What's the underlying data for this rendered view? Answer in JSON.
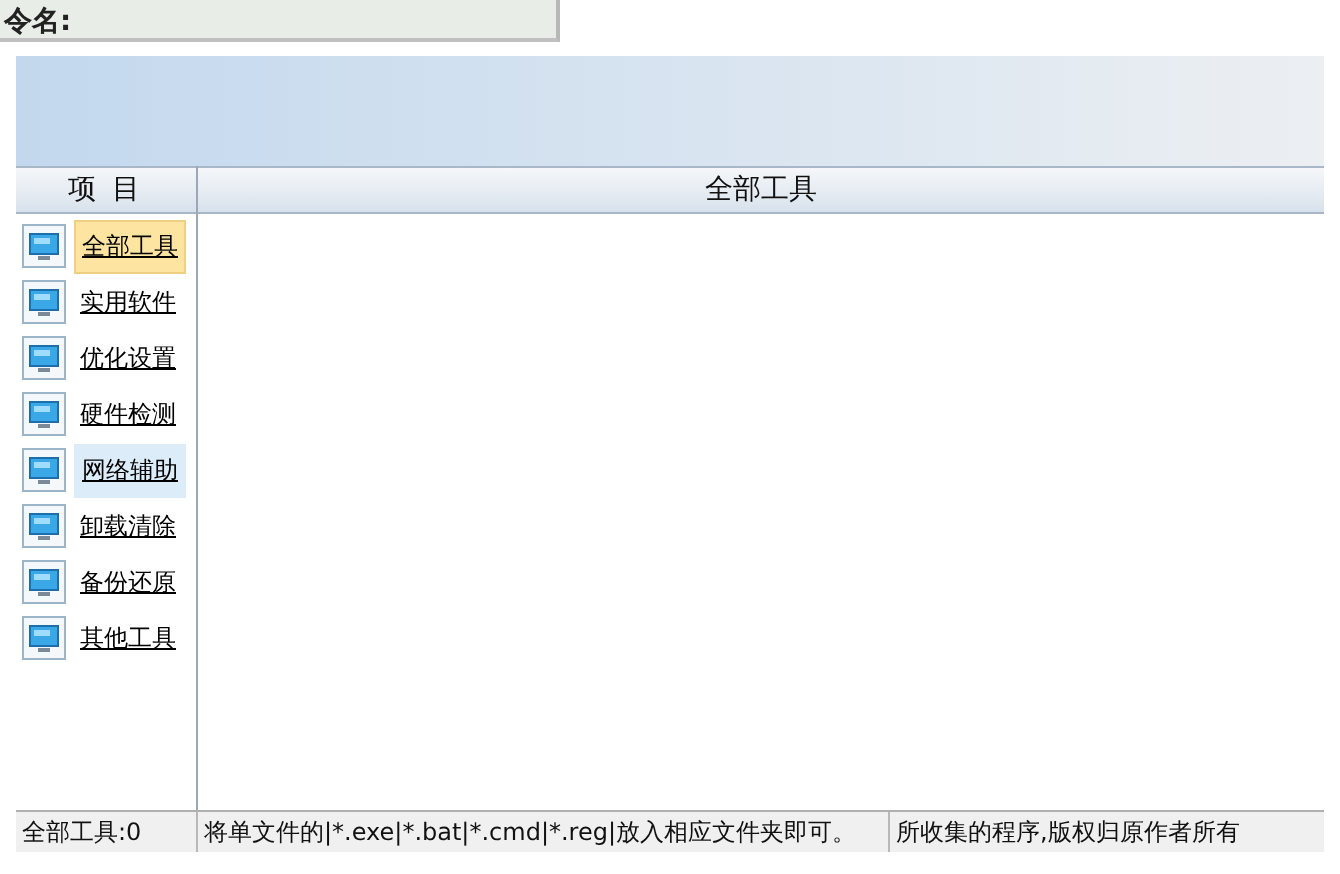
{
  "background_window": {
    "label": "令名:"
  },
  "window": {
    "columns": [
      "项 目",
      "全部工具"
    ],
    "categories": [
      {
        "label": "全部工具",
        "selected": true,
        "hot": false
      },
      {
        "label": "实用软件",
        "selected": false,
        "hot": false
      },
      {
        "label": "优化设置",
        "selected": false,
        "hot": false
      },
      {
        "label": "硬件检测",
        "selected": false,
        "hot": false
      },
      {
        "label": "网络辅助",
        "selected": false,
        "hot": true
      },
      {
        "label": "卸载清除",
        "selected": false,
        "hot": false
      },
      {
        "label": "备份还原",
        "selected": false,
        "hot": false
      },
      {
        "label": "其他工具",
        "selected": false,
        "hot": false
      }
    ],
    "status_bar": [
      "全部工具:0",
      "将单文件的|*.exe|*.bat|*.cmd|*.reg|放入相应文件夹即可。",
      "所收集的程序,版权归原作者所有"
    ]
  }
}
